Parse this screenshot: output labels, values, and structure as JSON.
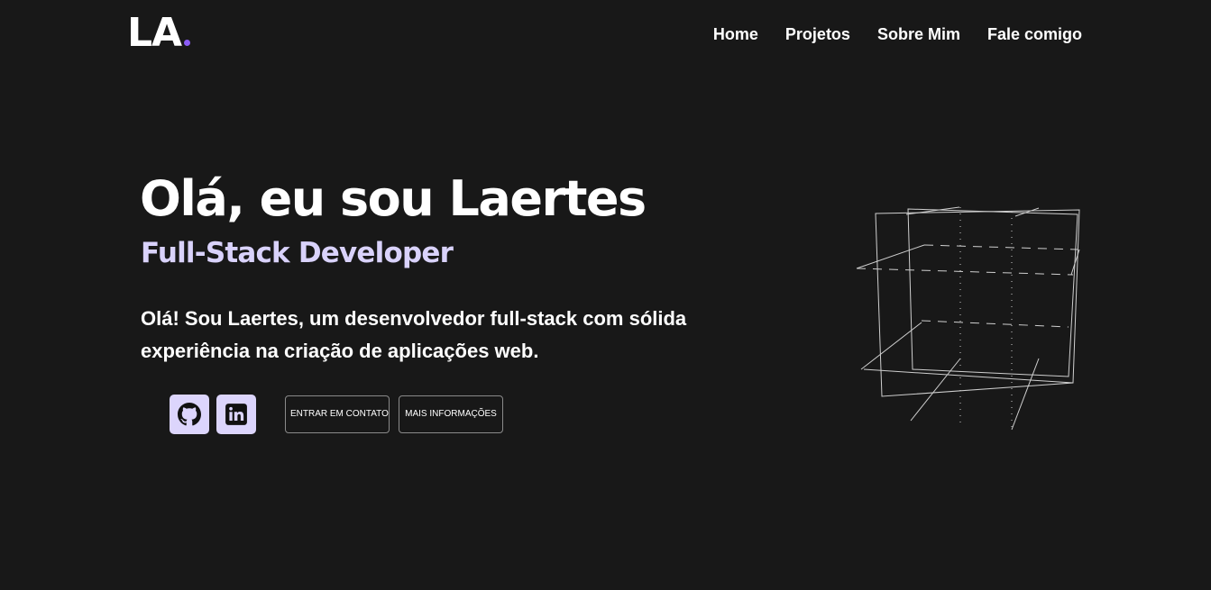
{
  "logo": {
    "text": "LA",
    "dot_color": "#8b5cf6"
  },
  "nav": {
    "items": [
      {
        "label": "Home"
      },
      {
        "label": "Projetos"
      },
      {
        "label": "Sobre Mim"
      },
      {
        "label": "Fale comigo"
      }
    ]
  },
  "hero": {
    "title": "Olá, eu sou Laertes",
    "subtitle": "Full-Stack Developer",
    "description": "Olá! Sou Laertes, um desenvolvedor full-stack com sólida experiência na criação de aplicações web."
  },
  "social": {
    "items": [
      {
        "icon": "github-icon"
      },
      {
        "icon": "linkedin-icon"
      }
    ],
    "button_color": "#dcd5fc"
  },
  "actions": {
    "contact_label": "ENTRAR EM CONTATO",
    "info_label": "MAIS INFORMAÇÕES"
  },
  "colors": {
    "background": "#181818",
    "accent": "#8b5cf6",
    "subtitle": "#d9d2fb"
  }
}
